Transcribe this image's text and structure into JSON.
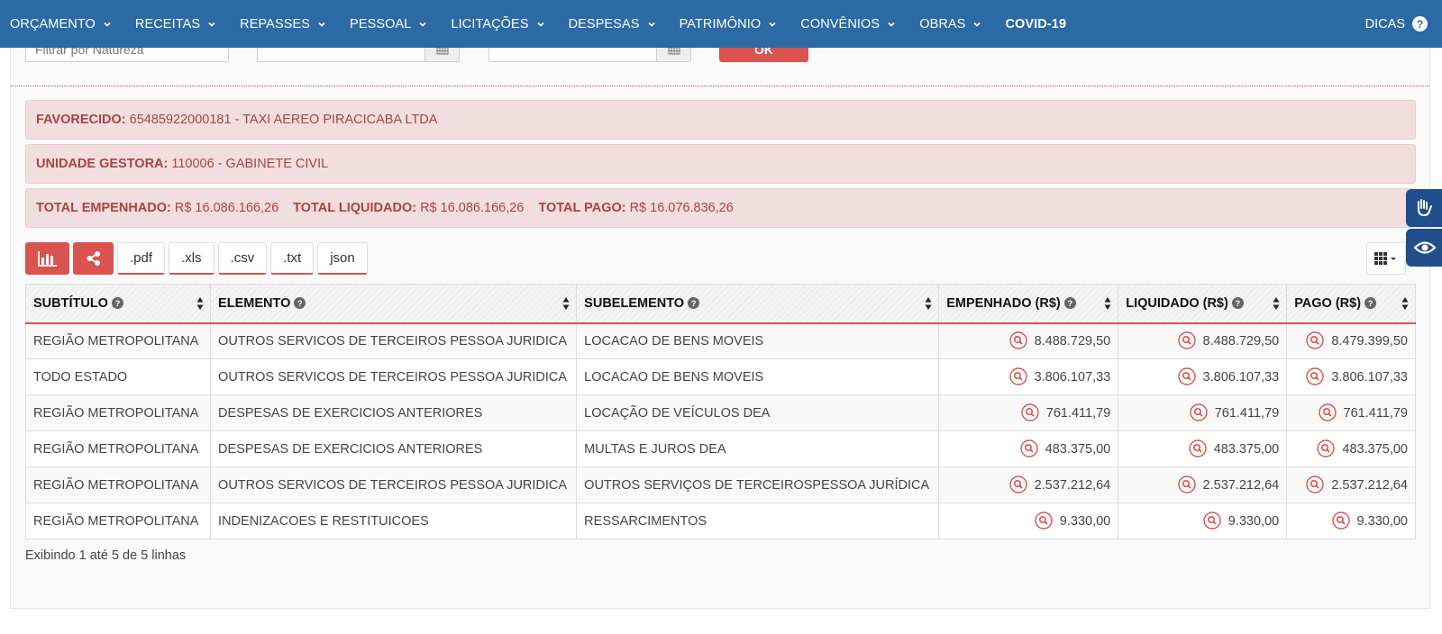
{
  "nav": {
    "items": [
      {
        "label": "ORÇAMENTO",
        "caret": true
      },
      {
        "label": "RECEITAS",
        "caret": true
      },
      {
        "label": "REPASSES",
        "caret": true
      },
      {
        "label": "PESSOAL",
        "caret": true
      },
      {
        "label": "LICITAÇÕES",
        "caret": true
      },
      {
        "label": "DESPESAS",
        "caret": true
      },
      {
        "label": "PATRIMÔNIO",
        "caret": true
      },
      {
        "label": "CONVÊNIOS",
        "caret": true
      },
      {
        "label": "OBRAS",
        "caret": true
      },
      {
        "label": "COVID-19",
        "caret": false
      }
    ],
    "help_label": "DICAS",
    "help_icon": "question-circle-icon"
  },
  "filters": {
    "natureza_placeholder": "Filtrar por Natureza",
    "ok_label": "OK"
  },
  "info": {
    "favorecido_label": "FAVORECIDO:",
    "favorecido_value": "65485922000181 - TAXI AEREO PIRACICABA LTDA",
    "unidade_label": "UNIDADE GESTORA:",
    "unidade_value": "110006 - GABINETE CIVIL",
    "empenhado_label": "TOTAL EMPENHADO:",
    "empenhado_value": "R$ 16.086.166,26",
    "liquidado_label": "TOTAL LIQUIDADO:",
    "liquidado_value": "R$ 16.086.166,26",
    "pago_label": "TOTAL PAGO:",
    "pago_value": "R$ 16.076.836,26"
  },
  "toolbar": {
    "export": [
      ".pdf",
      ".xls",
      ".csv",
      ".txt",
      "json"
    ]
  },
  "table": {
    "headers": [
      "SUBTÍTULO",
      "ELEMENTO",
      "SUBELEMENTO",
      "EMPENHADO (R$)",
      "LIQUIDADO (R$)",
      "PAGO (R$)"
    ],
    "rows": [
      [
        "REGIÃO METROPOLITANA",
        "OUTROS SERVICOS DE TERCEIROS PESSOA JURIDICA",
        "LOCACAO DE BENS MOVEIS",
        "8.488.729,50",
        "8.488.729,50",
        "8.479.399,50"
      ],
      [
        "TODO ESTADO",
        "OUTROS SERVICOS DE TERCEIROS PESSOA JURIDICA",
        "LOCACAO DE BENS MOVEIS",
        "3.806.107,33",
        "3.806.107,33",
        "3.806.107,33"
      ],
      [
        "REGIÃO METROPOLITANA",
        "DESPESAS DE EXERCICIOS ANTERIORES",
        "LOCAÇÃO DE VEÍCULOS DEA",
        "761.411,79",
        "761.411,79",
        "761.411,79"
      ],
      [
        "REGIÃO METROPOLITANA",
        "DESPESAS DE EXERCICIOS ANTERIORES",
        "MULTAS E JUROS DEA",
        "483.375,00",
        "483.375,00",
        "483.375,00"
      ],
      [
        "REGIÃO METROPOLITANA",
        "OUTROS SERVICOS DE TERCEIROS PESSOA JURIDICA",
        "OUTROS SERVIÇOS DE TERCEIROSPESSOA JURÍDICA",
        "2.537.212,64",
        "2.537.212,64",
        "2.537.212,64"
      ],
      [
        "REGIÃO METROPOLITANA",
        "INDENIZACOES E RESTITUICOES",
        "RESSARCIMENTOS",
        "9.330,00",
        "9.330,00",
        "9.330,00"
      ]
    ],
    "footer": "Exibindo 1 até 5 de 5 linhas"
  },
  "colors": {
    "navbar": "#2b6aa4",
    "accent_red": "#d9534f",
    "alert_bg": "#f2dede",
    "alert_text": "#a94442"
  }
}
